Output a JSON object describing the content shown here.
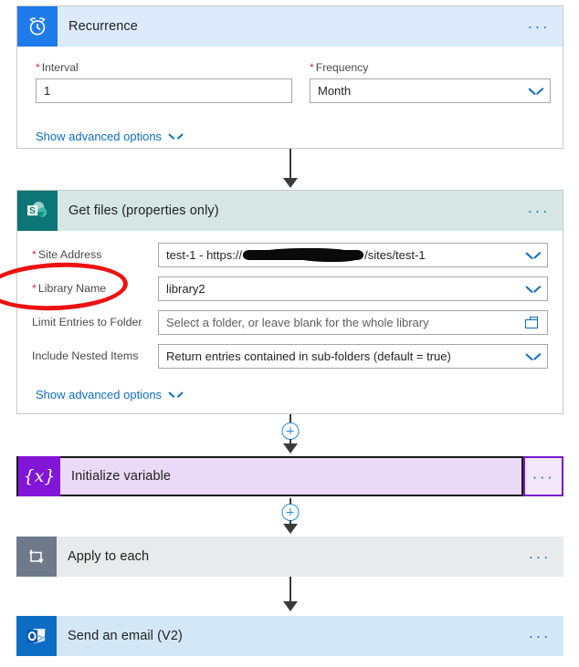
{
  "flow": {
    "steps": [
      {
        "id": "recurrence",
        "title": "Recurrence",
        "icon": "alarm-clock-icon",
        "menu": "···",
        "advanced_label": "Show advanced options",
        "fields": [
          {
            "label": "Interval",
            "required": true,
            "value": "1",
            "control": "text"
          },
          {
            "label": "Frequency",
            "required": true,
            "value": "Month",
            "control": "dropdown"
          }
        ]
      },
      {
        "id": "get-files",
        "title": "Get files (properties only)",
        "icon": "sharepoint-icon",
        "menu": "···",
        "advanced_label": "Show advanced options",
        "fields": [
          {
            "label": "Site Address",
            "required": true,
            "value_prefix": "test-1 - https://",
            "value_redacted": true,
            "value_suffix": "/sites/test-1",
            "control": "dropdown"
          },
          {
            "label": "Library Name",
            "required": true,
            "value": "library2",
            "control": "dropdown"
          },
          {
            "label": "Limit Entries to Folder",
            "required": false,
            "placeholder": "Select a folder, or leave blank for the whole library",
            "control": "folder-picker"
          },
          {
            "label": "Include Nested Items",
            "required": false,
            "value": "Return entries contained in sub-folders (default = true)",
            "control": "dropdown"
          }
        ]
      },
      {
        "id": "initialize-variable",
        "title": "Initialize variable",
        "icon": "variable-braces-icon",
        "menu": "···",
        "selected": true
      },
      {
        "id": "apply-to-each",
        "title": "Apply to each",
        "icon": "loop-icon",
        "menu": "···"
      },
      {
        "id": "send-an-email",
        "title": "Send an email (V2)",
        "icon": "outlook-icon",
        "menu": "···"
      }
    ],
    "connectors": [
      {
        "from": "recurrence",
        "to": "get-files",
        "has_add_button": false
      },
      {
        "from": "get-files",
        "to": "initialize-variable",
        "has_add_button": true
      },
      {
        "from": "initialize-variable",
        "to": "apply-to-each",
        "has_add_button": true
      },
      {
        "from": "apply-to-each",
        "to": "send-an-email",
        "has_add_button": false
      }
    ]
  },
  "annotation": {
    "type": "hand-drawn-ellipse",
    "color": "#ee1111",
    "targets": "Library Name"
  },
  "colors": {
    "recurrence_header": "#dceafc",
    "recurrence_icon": "#1f7bec",
    "sharepoint_header": "#d6e6e4",
    "sharepoint_icon": "#0d7575",
    "variable_bar": "#ead9f7",
    "variable_icon": "#8215d8",
    "variable_border": "#7719cf",
    "apply_bar": "#e9eaeb",
    "apply_icon": "#6e7a8a",
    "email_bar": "#d3e7f7",
    "email_icon": "#0d6cc4",
    "accent_link": "#0f6cbd",
    "required_asterisk": "#d13438",
    "connector": "#3b3b3b",
    "plus_node": "#1f8ae0"
  }
}
